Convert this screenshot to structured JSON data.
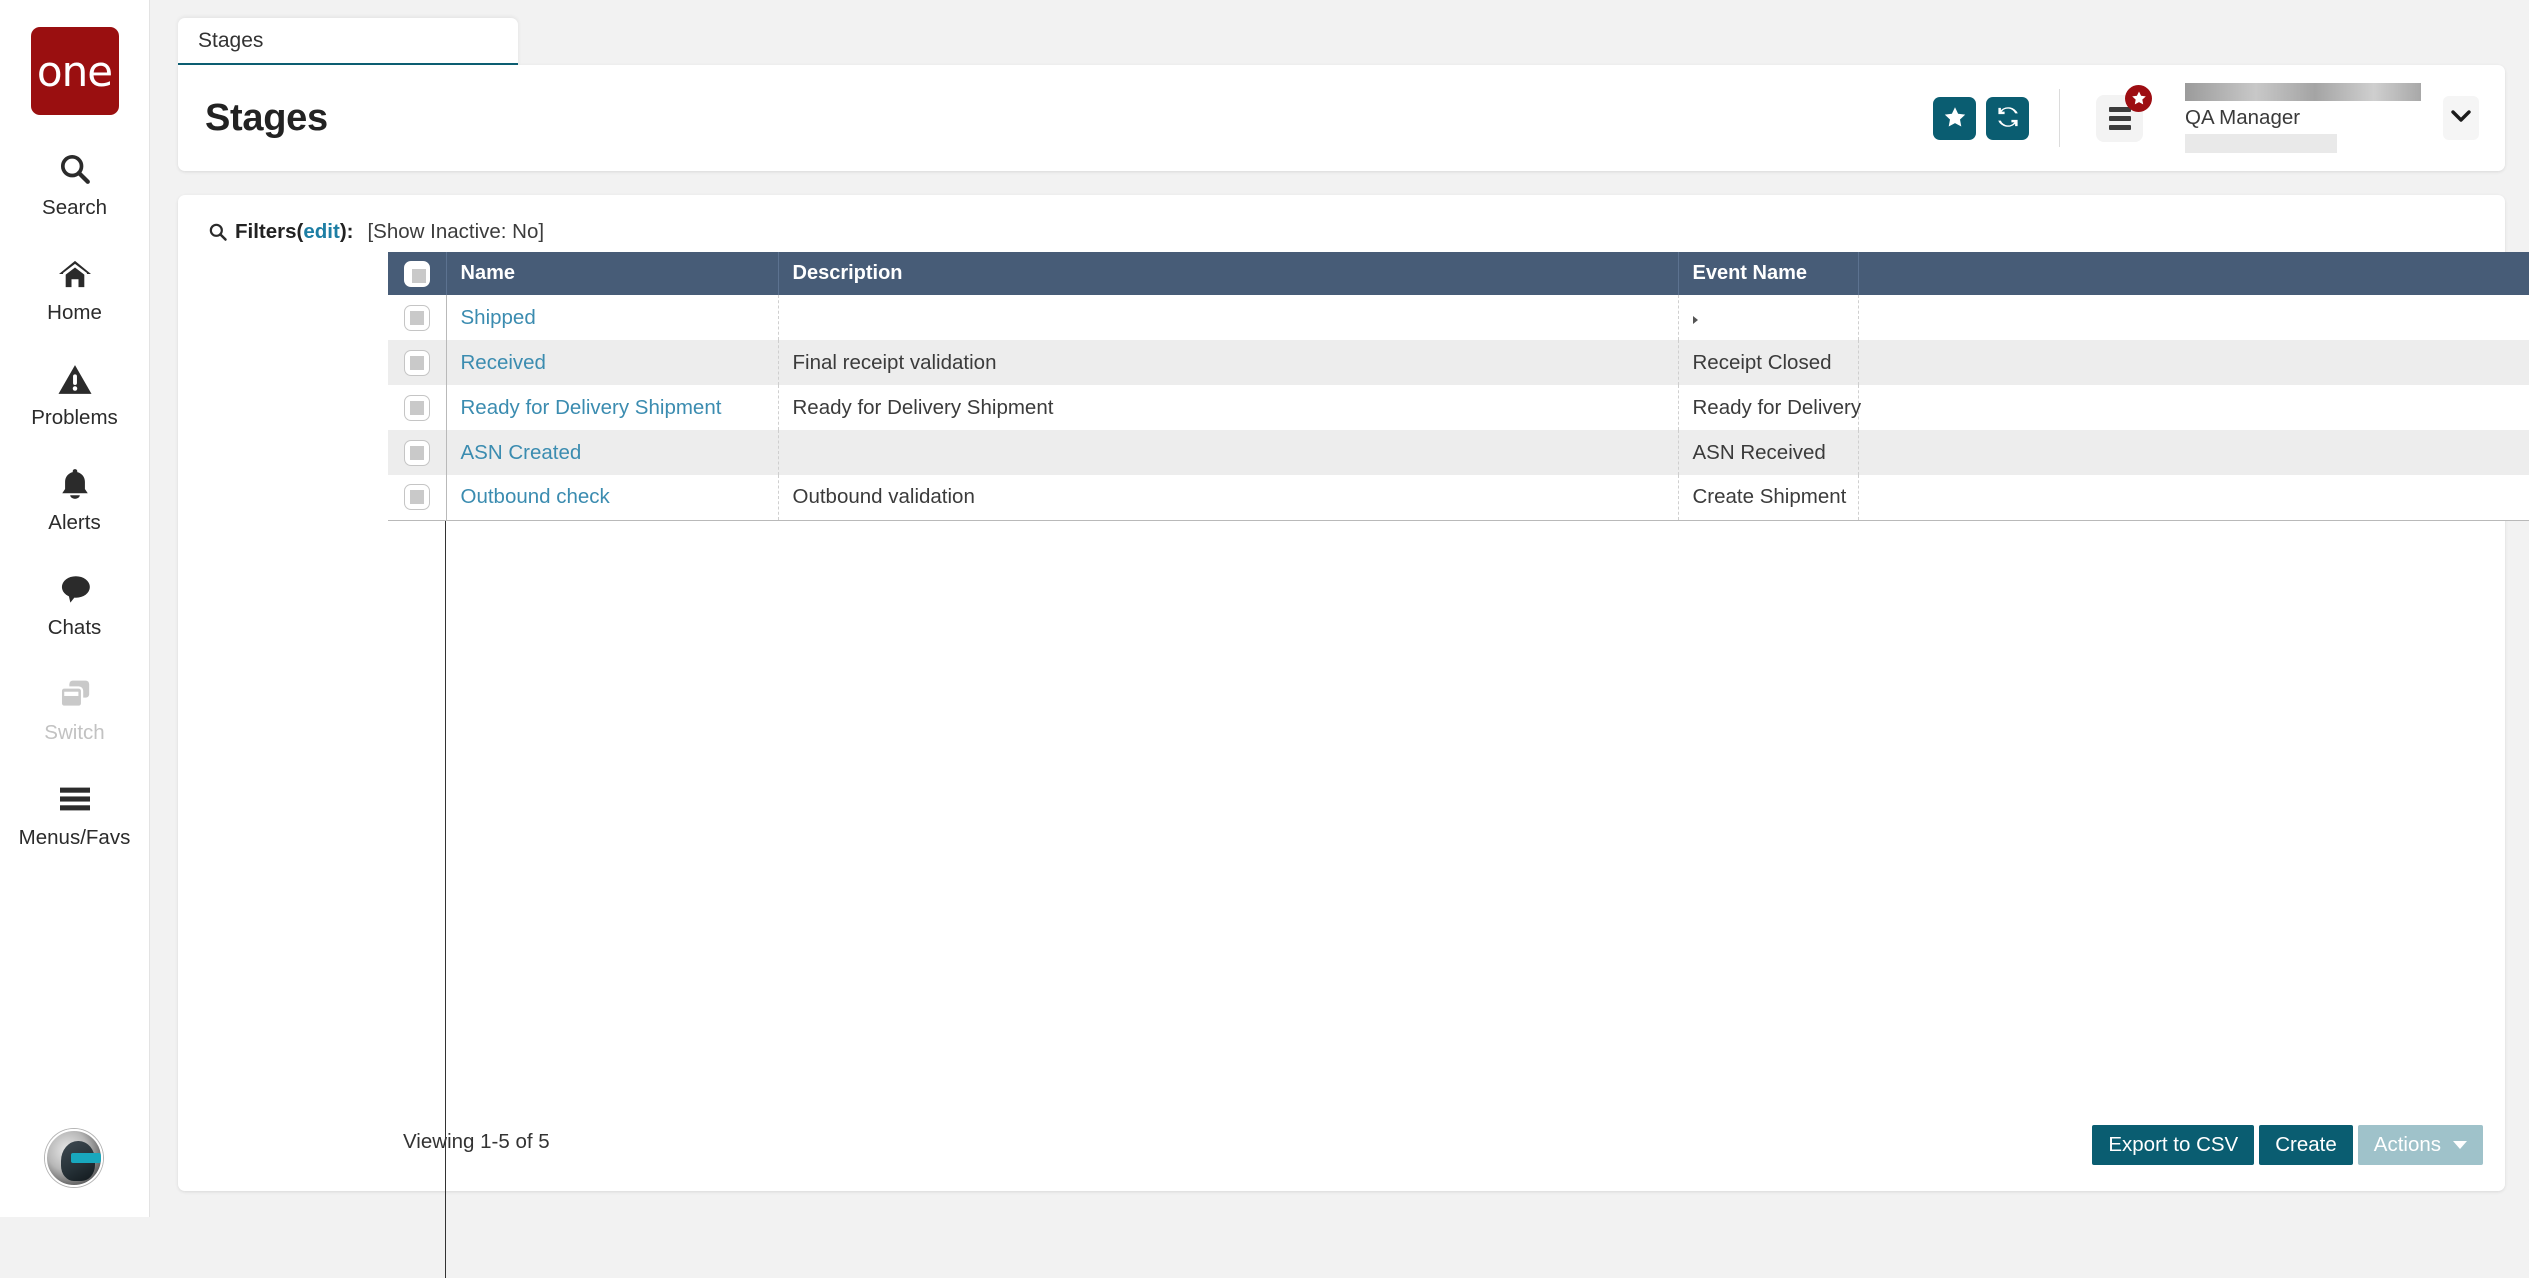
{
  "brand": {
    "logo_text": "one"
  },
  "sidebar": {
    "items": [
      {
        "label": "Search",
        "icon": "search-icon",
        "disabled": false
      },
      {
        "label": "Home",
        "icon": "home-icon",
        "disabled": false
      },
      {
        "label": "Problems",
        "icon": "warning-icon",
        "disabled": false
      },
      {
        "label": "Alerts",
        "icon": "bell-icon",
        "disabled": false
      },
      {
        "label": "Chats",
        "icon": "chat-icon",
        "disabled": false
      },
      {
        "label": "Switch",
        "icon": "switch-icon",
        "disabled": true
      },
      {
        "label": "Menus/Favs",
        "icon": "hamburger-icon",
        "disabled": false
      }
    ],
    "avatar": "user-avatar"
  },
  "tabs": [
    {
      "label": "Stages",
      "active": true
    }
  ],
  "header": {
    "title": "Stages",
    "favorite_icon": "star-icon",
    "refresh_icon": "refresh-icon",
    "menus_favs_icon": "menu-list-icon",
    "badge_icon": "star-badge-icon",
    "user_role": "QA Manager",
    "user_caret_icon": "chevron-down-icon"
  },
  "filters": {
    "icon": "search-icon",
    "label": "Filters",
    "edit_label": "edit",
    "paren_open": "(",
    "paren_close": ")",
    "colon": ":",
    "summary": "[Show Inactive: No]"
  },
  "table": {
    "columns": [
      {
        "key": "check",
        "label": ""
      },
      {
        "key": "name",
        "label": "Name"
      },
      {
        "key": "description",
        "label": "Description"
      },
      {
        "key": "event",
        "label": "Event Name"
      },
      {
        "key": "filler",
        "label": ""
      }
    ],
    "rows": [
      {
        "name": "Shipped",
        "description": "",
        "event": ""
      },
      {
        "name": "Received",
        "description": "Final receipt validation",
        "event": "Receipt Closed"
      },
      {
        "name": "Ready for Delivery Shipment",
        "description": "Ready for Delivery Shipment",
        "event": "Ready for Delivery"
      },
      {
        "name": "ASN Created",
        "description": "",
        "event": "ASN Received"
      },
      {
        "name": "Outbound check",
        "description": "Outbound validation",
        "event": "Create Shipment"
      }
    ]
  },
  "footer": {
    "viewing": "Viewing 1-5 of 5",
    "export_label": "Export to CSV",
    "create_label": "Create",
    "actions_label": "Actions"
  },
  "colors": {
    "brand_red": "#9a0f10",
    "accent_teal": "#0a5d71",
    "table_header": "#475c77",
    "link": "#3b8cb0",
    "badge_red": "#9d0d12",
    "muted_button": "#9fc2ca"
  }
}
